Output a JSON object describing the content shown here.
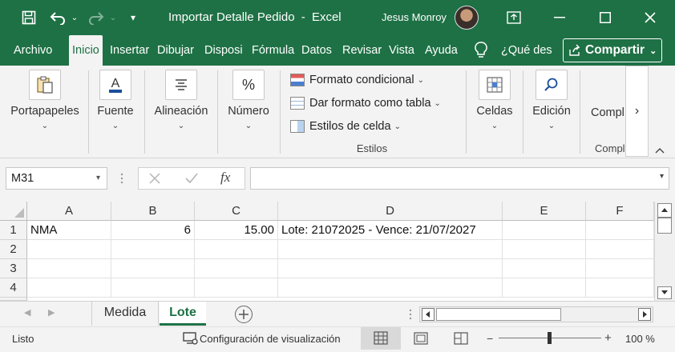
{
  "title": {
    "document": "Importar Detalle Pedido",
    "separator": "-",
    "app": "Excel",
    "user": "Jesus Monroy"
  },
  "tabs": [
    {
      "label": "Archivo"
    },
    {
      "label": "Inicio"
    },
    {
      "label": "Insertar"
    },
    {
      "label": "Dibujar"
    },
    {
      "label": "Disposi"
    },
    {
      "label": "Fórmula"
    },
    {
      "label": "Datos"
    },
    {
      "label": "Revisar"
    },
    {
      "label": "Vista"
    },
    {
      "label": "Ayuda"
    }
  ],
  "tell_me": "¿Qué des",
  "share_label": "Compartir",
  "ribbon": {
    "clipboard": "Portapapeles",
    "font": "Fuente",
    "alignment": "Alineación",
    "number": "Número",
    "cond_format": "Formato condicional",
    "format_table": "Dar formato como tabla",
    "cell_styles": "Estilos de celda",
    "styles_group": "Estilos",
    "cells": "Celdas",
    "editing": "Edición",
    "comp": "Compl",
    "comp_group": "Compl",
    "more": "›"
  },
  "formula_bar": {
    "name_box": "M31",
    "fx_label": "fx",
    "value": ""
  },
  "grid": {
    "columns": [
      "A",
      "B",
      "C",
      "D",
      "E",
      "F"
    ],
    "rows": [
      "1",
      "2",
      "3",
      "4"
    ],
    "cells": {
      "A1": "NMA",
      "B1": "6",
      "C1": "15.00",
      "D1": "Lote: 21072025 - Vence: 21/07/2027"
    }
  },
  "sheets": [
    {
      "label": "Medida",
      "active": false
    },
    {
      "label": "Lote",
      "active": true
    }
  ],
  "status": {
    "ready": "Listo",
    "display_settings": "Configuración de visualización",
    "zoom": "100 %"
  },
  "colors": {
    "accent": "#1e7145",
    "ribbon_bg": "#f3f3f3"
  }
}
